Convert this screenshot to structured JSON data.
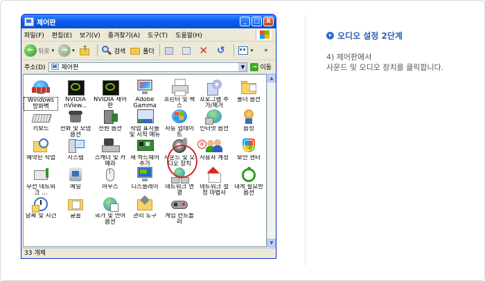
{
  "window": {
    "title": "제어판",
    "controls": [
      "_",
      "□",
      "X"
    ]
  },
  "menu": [
    "파일(F)",
    "편집(E)",
    "보기(V)",
    "즐겨찾기(A)",
    "도구(T)",
    "도움말(H)"
  ],
  "toolbar": {
    "back_label": "뒤로",
    "search_label": "검색",
    "folders_label": "폴더"
  },
  "address": {
    "label": "주소(D)",
    "value": "제어판",
    "go_label": "이동"
  },
  "items": [
    {
      "label": "Windows 방화벽",
      "icon": "firewall-icon"
    },
    {
      "label": "NVIDIA nView...",
      "icon": "nvidia-icon"
    },
    {
      "label": "NVIDIA 제어판",
      "icon": "nvidia-icon"
    },
    {
      "label": "Adobe Gamma",
      "icon": "monitor-icon"
    },
    {
      "label": "프린터 및 팩스",
      "icon": "printer-icon"
    },
    {
      "label": "프로그램 추가/제거",
      "icon": "programs-icon"
    },
    {
      "label": "폴더 옵션",
      "icon": "folder-icon"
    },
    {
      "label": "키보드",
      "icon": "keyboard-icon"
    },
    {
      "label": "전화 및 모뎀 옵션",
      "icon": "phone-icon"
    },
    {
      "label": "전원 옵션",
      "icon": "power-icon"
    },
    {
      "label": "작업 표시줄 및 시작 메뉴",
      "icon": "taskbar-icon"
    },
    {
      "label": "자동 업데이트",
      "icon": "update-icon"
    },
    {
      "label": "인터넷 옵션",
      "icon": "internet-icon"
    },
    {
      "label": "음성",
      "icon": "speech-icon"
    },
    {
      "label": "예약된 작업",
      "icon": "scheduled-icon"
    },
    {
      "label": "시스템",
      "icon": "system-icon"
    },
    {
      "label": "스캐너 및 카메라",
      "icon": "scanner-icon"
    },
    {
      "label": "새 하드웨어 추가",
      "icon": "hardware-icon"
    },
    {
      "label": "사운드 및 오디오 장치",
      "icon": "sound-icon"
    },
    {
      "label": "사용자 계정",
      "icon": "users-icon"
    },
    {
      "label": "보안 센터",
      "icon": "security-icon"
    },
    {
      "label": "무선 네트워크 ...",
      "icon": "wireless-icon"
    },
    {
      "label": "메일",
      "icon": "mail-icon"
    },
    {
      "label": "마우스",
      "icon": "mouse-icon"
    },
    {
      "label": "디스플레이",
      "icon": "display-icon"
    },
    {
      "label": "네트워크 연결",
      "icon": "network-icon"
    },
    {
      "label": "네트워크 설정 마법사",
      "icon": "network-wizard-icon"
    },
    {
      "label": "내게 필요한 옵션",
      "icon": "accessibility-icon"
    },
    {
      "label": "날짜 및 시간",
      "icon": "clock-icon"
    },
    {
      "label": "글꼴",
      "icon": "fonts-icon"
    },
    {
      "label": "국가 및 언어 옵션",
      "icon": "region-icon"
    },
    {
      "label": "관리 도구",
      "icon": "admin-icon"
    },
    {
      "label": "게임 컨트롤러",
      "icon": "gamepad-icon"
    }
  ],
  "status": "33 개체",
  "badge": "④",
  "instruction": {
    "title": "오디오 설정 2단계",
    "line1": "4) 제어판에서",
    "line2": "사운드 및 오디오 장치를 클릭합니다."
  }
}
